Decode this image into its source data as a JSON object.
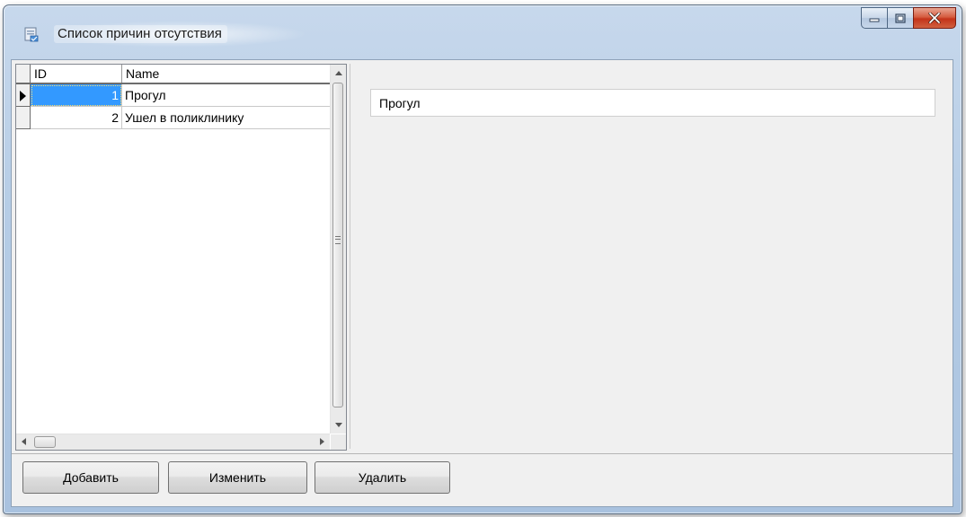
{
  "window": {
    "title": "Список причин отсутствия",
    "icons": {
      "app": "window-app-icon",
      "minimize": "minimize-icon",
      "maximize": "maximize-icon",
      "close": "close-icon"
    }
  },
  "grid": {
    "columns": [
      "ID",
      "Name"
    ],
    "rows": [
      {
        "id": "1",
        "name": "Прогул",
        "current": true
      },
      {
        "id": "2",
        "name": "Ушел в поликлинику",
        "current": false
      }
    ]
  },
  "detail": {
    "name_value": "Прогул"
  },
  "toolbar": {
    "add_label": "Добавить",
    "edit_label": "Изменить",
    "delete_label": "Удалить"
  },
  "colors": {
    "selection": "#3399ff",
    "close_button": "#c4331a",
    "frame": "#b6cde6"
  }
}
